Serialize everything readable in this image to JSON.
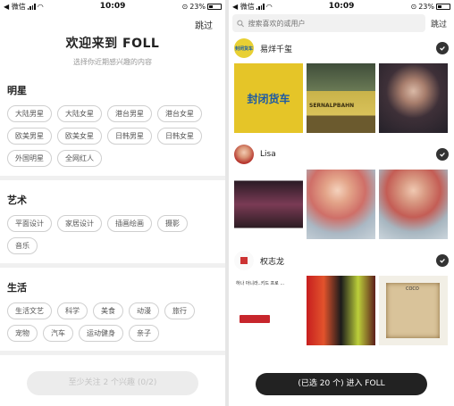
{
  "left": {
    "status": {
      "carrier": "◀ 微信",
      "time": "10:09",
      "battery": "23%"
    },
    "skip": "跳过",
    "title": "欢迎来到 FOLL",
    "subtitle": "选择你近期感兴趣的内容",
    "sections": [
      {
        "title": "明星",
        "chips": [
          "大陆男星",
          "大陆女星",
          "港台男星",
          "港台女星",
          "欧美男星",
          "欧美女星",
          "日韩男星",
          "日韩女星",
          "外国明星",
          "全网红人"
        ]
      },
      {
        "title": "艺术",
        "chips": [
          "平面设计",
          "家居设计",
          "插画绘画",
          "摄影",
          "音乐"
        ]
      },
      {
        "title": "生活",
        "chips": [
          "生活文艺",
          "科学",
          "美食",
          "动漫",
          "旅行",
          "宠物",
          "汽车",
          "运动健身",
          "亲子"
        ]
      }
    ],
    "cta": "至少关注 2 个兴趣 (0/2)"
  },
  "right": {
    "status": {
      "carrier": "◀ 微信",
      "time": "10:09",
      "battery": "23%"
    },
    "search_placeholder": "搜索喜欢的或用户",
    "skip": "跳过",
    "users": [
      {
        "name": "易烊千玺",
        "avatar_text": "封闭货车",
        "photo_texts": [
          "封闭货车",
          "SERNALPBAHN",
          ""
        ]
      },
      {
        "name": "Lisa",
        "photo_texts": [
          "",
          "",
          ""
        ]
      },
      {
        "name": "权志龙",
        "photo_texts": [
          "하나 아니라..키드 프로 ...",
          "",
          "COCO"
        ]
      }
    ],
    "cta": "(已选 20 个) 进入 FOLL"
  },
  "colors": {
    "accent_dark": "#222222",
    "chip_border": "#cfcfcf",
    "disabled_btn": "#ececec"
  }
}
